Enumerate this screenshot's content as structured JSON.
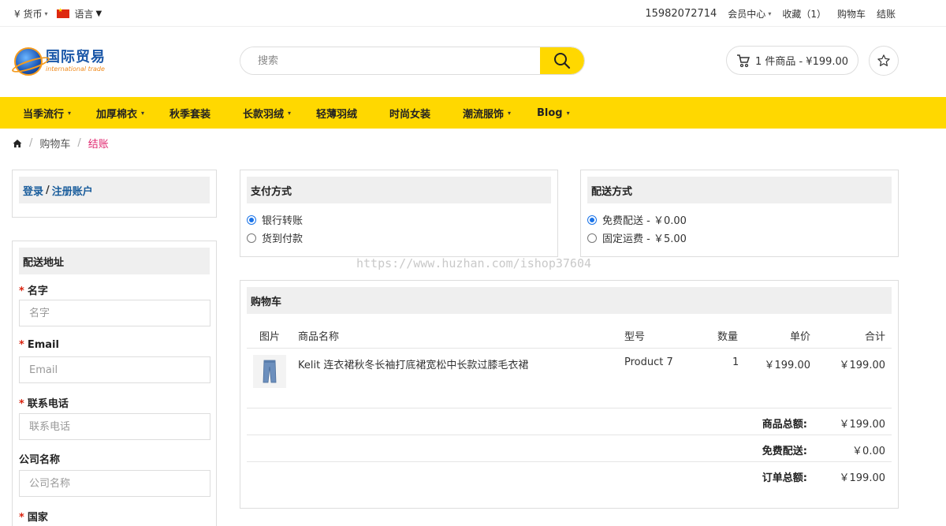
{
  "topbar": {
    "currency_label": "¥ 货币",
    "language_label": "语言",
    "phone": "15982072714",
    "member_center": "会员中心",
    "favorites": "收藏（1）",
    "cart": "购物车",
    "checkout": "结账"
  },
  "header": {
    "logo_cn": "国际贸易",
    "logo_en": "international trade",
    "search_placeholder": "搜索",
    "cart_summary": "1 件商品 - ¥199.00"
  },
  "nav": {
    "items": [
      {
        "label": "当季流行",
        "has_dropdown": true
      },
      {
        "label": "加厚棉衣",
        "has_dropdown": true
      },
      {
        "label": "秋季套装",
        "has_dropdown": false
      },
      {
        "label": "长款羽绒",
        "has_dropdown": true
      },
      {
        "label": "轻薄羽绒",
        "has_dropdown": false
      },
      {
        "label": "时尚女装",
        "has_dropdown": false
      },
      {
        "label": "潮流服饰",
        "has_dropdown": true
      },
      {
        "label": "Blog",
        "has_dropdown": true
      }
    ]
  },
  "breadcrumb": {
    "cart": "购物车",
    "current": "结账"
  },
  "login": {
    "login_label": "登录",
    "sep": "/",
    "register_label": "注册账户"
  },
  "shipping_address": {
    "title": "配送地址",
    "fields": [
      {
        "label": "名字",
        "placeholder": "名字",
        "required": true
      },
      {
        "label": "Email",
        "placeholder": "Email",
        "required": true
      },
      {
        "label": "联系电话",
        "placeholder": "联系电话",
        "required": true
      },
      {
        "label": "公司名称",
        "placeholder": "公司名称",
        "required": false
      },
      {
        "label": "国家",
        "placeholder": "",
        "required": true
      }
    ]
  },
  "payment": {
    "title": "支付方式",
    "options": [
      {
        "label": "银行转账",
        "selected": true
      },
      {
        "label": "货到付款",
        "selected": false
      }
    ]
  },
  "delivery": {
    "title": "配送方式",
    "options": [
      {
        "label": "免费配送 - ￥0.00",
        "selected": true
      },
      {
        "label": "固定运费 - ￥5.00",
        "selected": false
      }
    ]
  },
  "cart": {
    "title": "购物车",
    "headers": {
      "image": "图片",
      "name": "商品名称",
      "model": "型号",
      "qty": "数量",
      "price": "单价",
      "total": "合计"
    },
    "rows": [
      {
        "name": "Kelit 连衣裙秋冬长袖打底裙宽松中长款过膝毛衣裙",
        "model": "Product 7",
        "qty": "1",
        "price": "￥199.00",
        "total": "￥199.00"
      }
    ],
    "totals": [
      {
        "label": "商品总额:",
        "value": "￥199.00"
      },
      {
        "label": "免费配送:",
        "value": "￥0.00"
      },
      {
        "label": "订单总额:",
        "value": "￥199.00"
      }
    ]
  },
  "watermark": "https://www.huzhan.com/ishop37604",
  "colors": {
    "accent_yellow": "#ffd800",
    "link_blue": "#1a5d9c",
    "breadcrumb_current": "#e0266f",
    "required_red": "#d9230f"
  }
}
